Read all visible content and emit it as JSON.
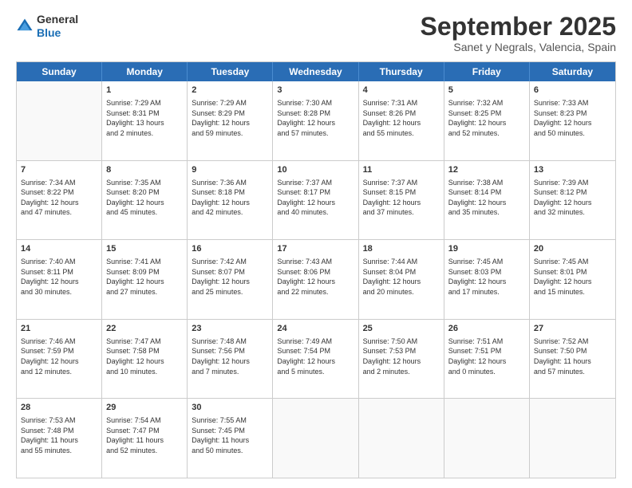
{
  "header": {
    "logo_line1": "General",
    "logo_line2": "Blue",
    "title": "September 2025",
    "subtitle": "Sanet y Negrals, Valencia, Spain"
  },
  "days": [
    "Sunday",
    "Monday",
    "Tuesday",
    "Wednesday",
    "Thursday",
    "Friday",
    "Saturday"
  ],
  "weeks": [
    [
      {
        "day": "",
        "info": ""
      },
      {
        "day": "1",
        "info": "Sunrise: 7:29 AM\nSunset: 8:31 PM\nDaylight: 13 hours\nand 2 minutes."
      },
      {
        "day": "2",
        "info": "Sunrise: 7:29 AM\nSunset: 8:29 PM\nDaylight: 12 hours\nand 59 minutes."
      },
      {
        "day": "3",
        "info": "Sunrise: 7:30 AM\nSunset: 8:28 PM\nDaylight: 12 hours\nand 57 minutes."
      },
      {
        "day": "4",
        "info": "Sunrise: 7:31 AM\nSunset: 8:26 PM\nDaylight: 12 hours\nand 55 minutes."
      },
      {
        "day": "5",
        "info": "Sunrise: 7:32 AM\nSunset: 8:25 PM\nDaylight: 12 hours\nand 52 minutes."
      },
      {
        "day": "6",
        "info": "Sunrise: 7:33 AM\nSunset: 8:23 PM\nDaylight: 12 hours\nand 50 minutes."
      }
    ],
    [
      {
        "day": "7",
        "info": "Sunrise: 7:34 AM\nSunset: 8:22 PM\nDaylight: 12 hours\nand 47 minutes."
      },
      {
        "day": "8",
        "info": "Sunrise: 7:35 AM\nSunset: 8:20 PM\nDaylight: 12 hours\nand 45 minutes."
      },
      {
        "day": "9",
        "info": "Sunrise: 7:36 AM\nSunset: 8:18 PM\nDaylight: 12 hours\nand 42 minutes."
      },
      {
        "day": "10",
        "info": "Sunrise: 7:37 AM\nSunset: 8:17 PM\nDaylight: 12 hours\nand 40 minutes."
      },
      {
        "day": "11",
        "info": "Sunrise: 7:37 AM\nSunset: 8:15 PM\nDaylight: 12 hours\nand 37 minutes."
      },
      {
        "day": "12",
        "info": "Sunrise: 7:38 AM\nSunset: 8:14 PM\nDaylight: 12 hours\nand 35 minutes."
      },
      {
        "day": "13",
        "info": "Sunrise: 7:39 AM\nSunset: 8:12 PM\nDaylight: 12 hours\nand 32 minutes."
      }
    ],
    [
      {
        "day": "14",
        "info": "Sunrise: 7:40 AM\nSunset: 8:11 PM\nDaylight: 12 hours\nand 30 minutes."
      },
      {
        "day": "15",
        "info": "Sunrise: 7:41 AM\nSunset: 8:09 PM\nDaylight: 12 hours\nand 27 minutes."
      },
      {
        "day": "16",
        "info": "Sunrise: 7:42 AM\nSunset: 8:07 PM\nDaylight: 12 hours\nand 25 minutes."
      },
      {
        "day": "17",
        "info": "Sunrise: 7:43 AM\nSunset: 8:06 PM\nDaylight: 12 hours\nand 22 minutes."
      },
      {
        "day": "18",
        "info": "Sunrise: 7:44 AM\nSunset: 8:04 PM\nDaylight: 12 hours\nand 20 minutes."
      },
      {
        "day": "19",
        "info": "Sunrise: 7:45 AM\nSunset: 8:03 PM\nDaylight: 12 hours\nand 17 minutes."
      },
      {
        "day": "20",
        "info": "Sunrise: 7:45 AM\nSunset: 8:01 PM\nDaylight: 12 hours\nand 15 minutes."
      }
    ],
    [
      {
        "day": "21",
        "info": "Sunrise: 7:46 AM\nSunset: 7:59 PM\nDaylight: 12 hours\nand 12 minutes."
      },
      {
        "day": "22",
        "info": "Sunrise: 7:47 AM\nSunset: 7:58 PM\nDaylight: 12 hours\nand 10 minutes."
      },
      {
        "day": "23",
        "info": "Sunrise: 7:48 AM\nSunset: 7:56 PM\nDaylight: 12 hours\nand 7 minutes."
      },
      {
        "day": "24",
        "info": "Sunrise: 7:49 AM\nSunset: 7:54 PM\nDaylight: 12 hours\nand 5 minutes."
      },
      {
        "day": "25",
        "info": "Sunrise: 7:50 AM\nSunset: 7:53 PM\nDaylight: 12 hours\nand 2 minutes."
      },
      {
        "day": "26",
        "info": "Sunrise: 7:51 AM\nSunset: 7:51 PM\nDaylight: 12 hours\nand 0 minutes."
      },
      {
        "day": "27",
        "info": "Sunrise: 7:52 AM\nSunset: 7:50 PM\nDaylight: 11 hours\nand 57 minutes."
      }
    ],
    [
      {
        "day": "28",
        "info": "Sunrise: 7:53 AM\nSunset: 7:48 PM\nDaylight: 11 hours\nand 55 minutes."
      },
      {
        "day": "29",
        "info": "Sunrise: 7:54 AM\nSunset: 7:47 PM\nDaylight: 11 hours\nand 52 minutes."
      },
      {
        "day": "30",
        "info": "Sunrise: 7:55 AM\nSunset: 7:45 PM\nDaylight: 11 hours\nand 50 minutes."
      },
      {
        "day": "",
        "info": ""
      },
      {
        "day": "",
        "info": ""
      },
      {
        "day": "",
        "info": ""
      },
      {
        "day": "",
        "info": ""
      }
    ]
  ]
}
